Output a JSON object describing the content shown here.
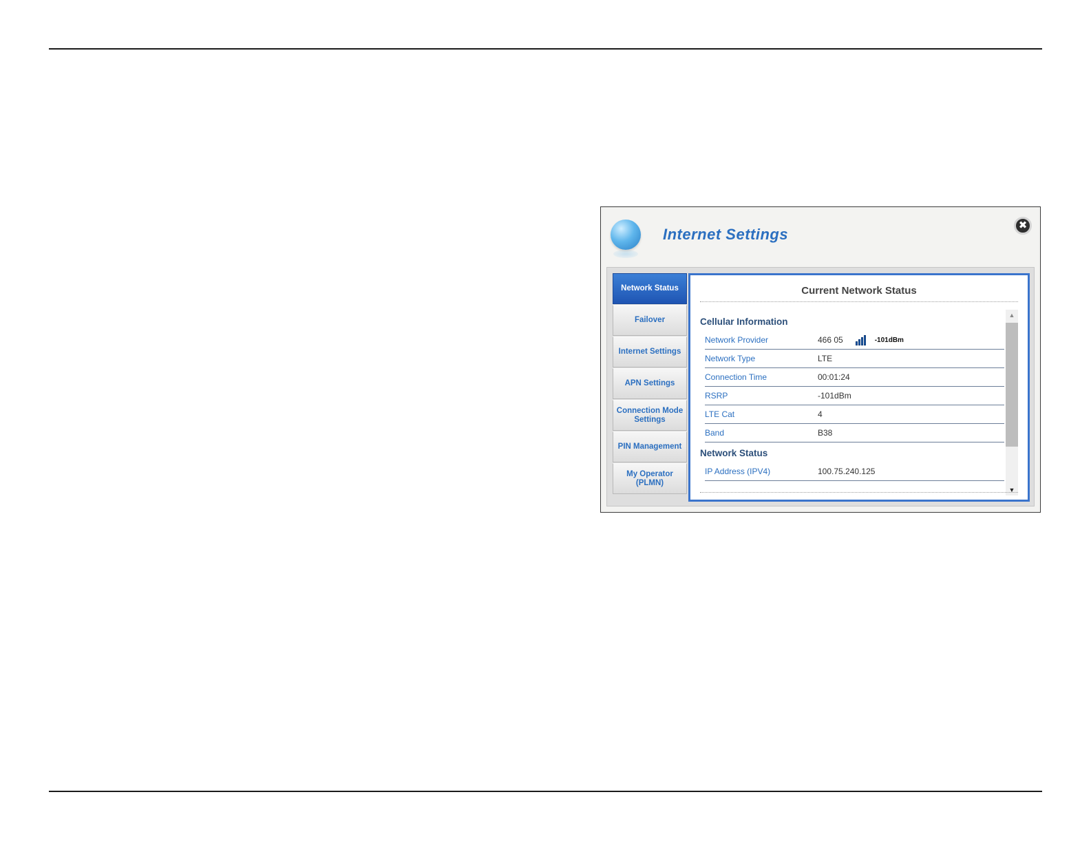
{
  "window": {
    "title": "Internet Settings",
    "close_glyph": "✖",
    "icon": "globe-icon"
  },
  "sidebar": {
    "items": [
      {
        "label": "Network Status",
        "active": true
      },
      {
        "label": "Failover"
      },
      {
        "label": "Internet Settings"
      },
      {
        "label": "APN Settings"
      },
      {
        "label": "Connection Mode Settings"
      },
      {
        "label": "PIN Management"
      },
      {
        "label": "My Operator (PLMN)"
      }
    ]
  },
  "content": {
    "title": "Current Network Status",
    "cellular": {
      "heading": "Cellular Information",
      "rows": [
        {
          "label": "Network Provider",
          "value": "466 05",
          "signal_text": "-101dBm"
        },
        {
          "label": "Network Type",
          "value": "LTE"
        },
        {
          "label": "Connection Time",
          "value": "00:01:24"
        },
        {
          "label": "RSRP",
          "value": "-101dBm"
        },
        {
          "label": "LTE Cat",
          "value": "4"
        },
        {
          "label": "Band",
          "value": "B38"
        }
      ]
    },
    "network": {
      "heading": "Network Status",
      "rows": [
        {
          "label": "IP Address (IPV4)",
          "value": "100.75.240.125"
        }
      ]
    }
  },
  "scrollbar": {
    "up_glyph": "▲",
    "down_glyph": "▼"
  },
  "colors": {
    "accent": "#2b6fc0",
    "active_tab": "#1f55b3",
    "frame_border": "#3a74cc"
  }
}
